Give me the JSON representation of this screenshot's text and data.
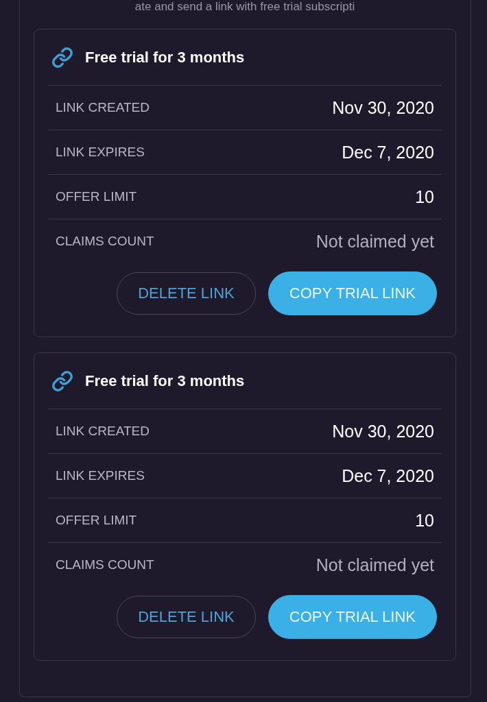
{
  "intro": {
    "text": "ate and send a link with free trial subscripti"
  },
  "trial_links": [
    {
      "title": "Free trial for 3 months",
      "details": [
        {
          "label": "LINK CREATED",
          "value": "Nov 30, 2020",
          "muted": false
        },
        {
          "label": "LINK EXPIRES",
          "value": "Dec 7, 2020",
          "muted": false
        },
        {
          "label": "OFFER LIMIT",
          "value": "10",
          "muted": false
        },
        {
          "label": "CLAIMS COUNT",
          "value": "Not claimed yet",
          "muted": true
        }
      ],
      "buttons": [
        {
          "label": "DELETE LINK",
          "kind": "outline"
        },
        {
          "label": "COPY TRIAL LINK",
          "kind": "filled"
        }
      ]
    },
    {
      "title": "Free trial for 3 months",
      "details": [
        {
          "label": "LINK CREATED",
          "value": "Nov 30, 2020",
          "muted": false
        },
        {
          "label": "LINK EXPIRES",
          "value": "Dec 7, 2020",
          "muted": false
        },
        {
          "label": "OFFER LIMIT",
          "value": "10",
          "muted": false
        },
        {
          "label": "CLAIMS COUNT",
          "value": "Not claimed yet",
          "muted": true
        }
      ],
      "buttons": [
        {
          "label": "DELETE LINK",
          "kind": "outline"
        },
        {
          "label": "COPY TRIAL LINK",
          "kind": "filled"
        }
      ]
    }
  ]
}
